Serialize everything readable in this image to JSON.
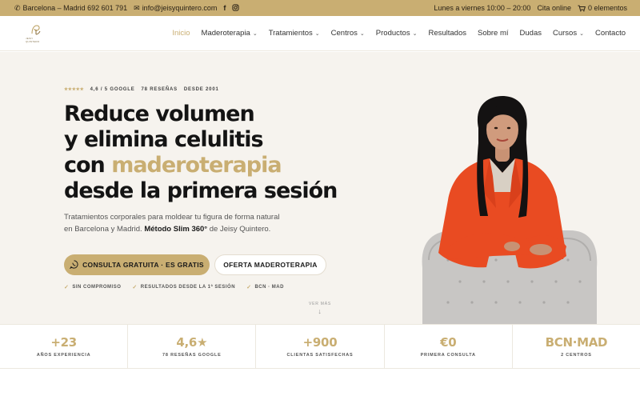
{
  "topbar": {
    "location_phone": "Barcelona – Madrid 692 601 791",
    "email": "info@jeisyquintero.com",
    "facebook_icon": "f",
    "instagram_icon": "instagram-icon",
    "hours": "Lunes a viernes 10:00 – 20:00",
    "appointment": "Cita online",
    "cart": "0 elementos"
  },
  "nav": {
    "items": [
      {
        "label": "Inicio",
        "dropdown": false
      },
      {
        "label": "Maderoterapia",
        "dropdown": true
      },
      {
        "label": "Tratamientos",
        "dropdown": true
      },
      {
        "label": "Centros",
        "dropdown": true
      },
      {
        "label": "Productos",
        "dropdown": true
      },
      {
        "label": "Resultados",
        "dropdown": false
      },
      {
        "label": "Sobre mí",
        "dropdown": false
      },
      {
        "label": "Dudas",
        "dropdown": false
      },
      {
        "label": "Cursos",
        "dropdown": true
      },
      {
        "label": "Contacto",
        "dropdown": false
      }
    ],
    "active_index": 0
  },
  "hero": {
    "stars": "★★★★★",
    "rating": "4,6 / 5 GOOGLE",
    "reviews": "78 RESEÑAS",
    "since": "DESDE 2001",
    "headline_line1": "Reduce volumen",
    "headline_line2": "y elimina celulitis",
    "headline_line3_prefix": "con ",
    "headline_line3_accent": "maderoterapia",
    "headline_line4": "desde la primera sesión",
    "sub_before": "Tratamientos corporales para moldear tu figura de forma natural en Barcelona y Madrid. ",
    "sub_bold": "Método Slim 360°",
    "sub_after": " de Jeisy Quintero.",
    "cta_primary": "CONSULTA GRATUITA · ES GRATIS",
    "cta_secondary": "OFERTA MADEROTERAPIA",
    "checks": [
      "SIN COMPROMISO",
      "RESULTADOS DESDE LA 1ª SESIÓN",
      "BCN · MAD"
    ],
    "scroll_hint": "VER MÁS"
  },
  "stats": [
    {
      "value": "+23",
      "label": "AÑOS EXPERIENCIA"
    },
    {
      "value": "4,6★",
      "label": "78 RESEÑAS GOOGLE"
    },
    {
      "value": "+900",
      "label": "CLIENTAS SATISFECHAS"
    },
    {
      "value": "€0",
      "label": "PRIMERA CONSULTA"
    },
    {
      "value": "BCN·MAD",
      "label": "2 CENTROS"
    }
  ],
  "colors": {
    "accent": "#c9ae72",
    "hero_bg": "#f6f3ee",
    "text": "#141414"
  }
}
